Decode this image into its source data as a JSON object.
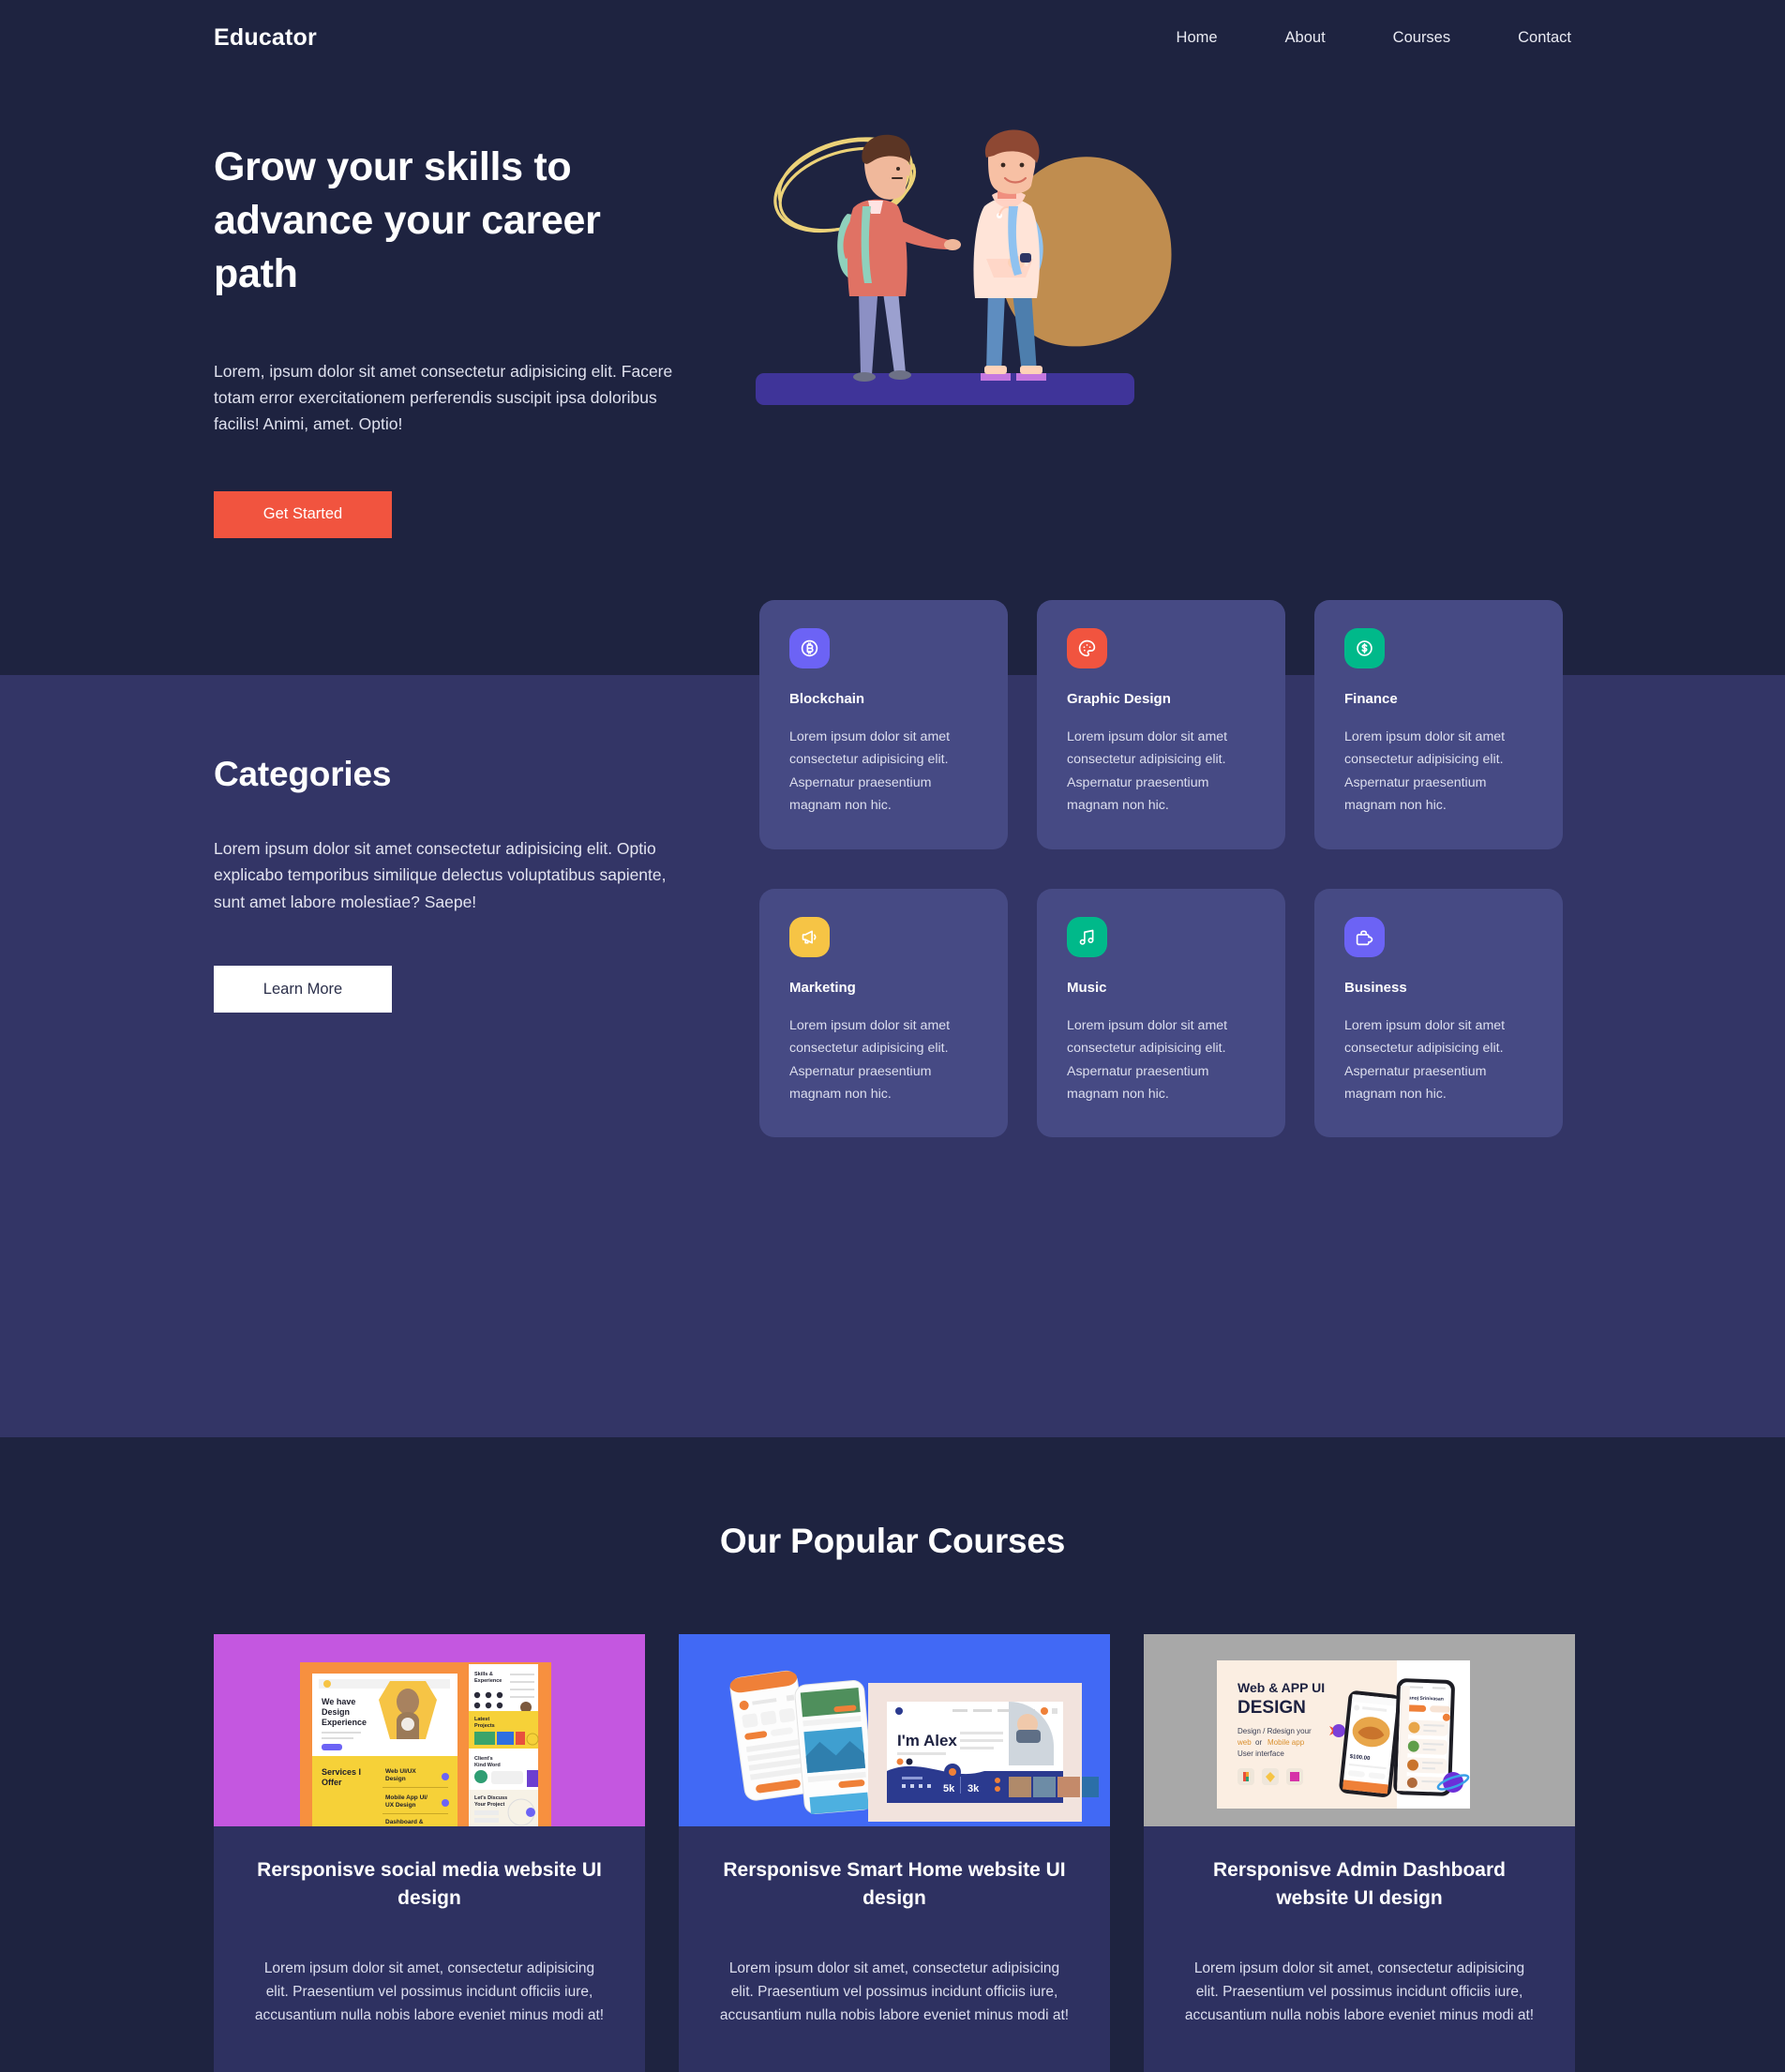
{
  "theme": {
    "bg_dark": "#1e2340",
    "bg_purple": "#333566",
    "card_purple": "#464a84",
    "accent_orange": "#f1543f",
    "course_card_bg": "#2e3161"
  },
  "nav": {
    "brand": "Educator",
    "links": [
      {
        "label": "Home"
      },
      {
        "label": "About"
      },
      {
        "label": "Courses"
      },
      {
        "label": "Contact"
      }
    ]
  },
  "hero": {
    "heading": "Grow your skills to advance your career path",
    "paragraph": "Lorem, ipsum dolor sit amet consectetur adipisicing elit. Facere totam error exercitationem perferendis suscipit ipsa doloribus facilis! Animi, amet. Optio!",
    "cta_label": "Get Started",
    "illustration_name": "two-students-illustration"
  },
  "categories": {
    "heading": "Categories",
    "paragraph": "Lorem ipsum dolor sit amet consectetur adipisicing elit. Optio explicabo temporibus similique delectus voluptatibus sapiente, sunt amet labore molestiae? Saepe!",
    "cta_label": "Learn More",
    "cards": [
      {
        "title": "Blockchain",
        "desc": "Lorem ipsum dolor sit amet consectetur adipisicing elit. Aspernatur praesentium magnam non hic.",
        "icon": "bitcoin-icon",
        "icon_bg": "#6c63f5"
      },
      {
        "title": "Graphic Design",
        "desc": "Lorem ipsum dolor sit amet consectetur adipisicing elit. Aspernatur praesentium magnam non hic.",
        "icon": "palette-icon",
        "icon_bg": "#f1543f"
      },
      {
        "title": "Finance",
        "desc": "Lorem ipsum dolor sit amet consectetur adipisicing elit. Aspernatur praesentium magnam non hic.",
        "icon": "dollar-coin-icon",
        "icon_bg": "#00b98a"
      },
      {
        "title": "Marketing",
        "desc": "Lorem ipsum dolor sit amet consectetur adipisicing elit. Aspernatur praesentium magnam non hic.",
        "icon": "megaphone-icon",
        "icon_bg": "#f6c445"
      },
      {
        "title": "Music",
        "desc": "Lorem ipsum dolor sit amet consectetur adipisicing elit. Aspernatur praesentium magnam non hic.",
        "icon": "music-note-icon",
        "icon_bg": "#00b98a"
      },
      {
        "title": "Business",
        "desc": "Lorem ipsum dolor sit amet consectetur adipisicing elit. Aspernatur praesentium magnam non hic.",
        "icon": "briefcase-icon",
        "icon_bg": "#6c63f5"
      }
    ]
  },
  "courses": {
    "heading": "Our Popular Courses",
    "items": [
      {
        "title": "Rersponisve social media website UI design",
        "desc": "Lorem ipsum dolor sit amet, consectetur adipisicing elit. Praesentium vel possimus incidunt officiis iure, accusantium nulla nobis labore eveniet minus modi at!",
        "thumb_bg": "#c457e0",
        "thumb_name": "social-media-ui-mockup",
        "thumb_texts": {
          "line1": "We have",
          "line2": "Design",
          "line3": "Experience",
          "services": "Services I Offer",
          "item1": "Web UI/UX Design",
          "item2": "Mobile App UI/ UX Design",
          "item3": "Dashboard &",
          "panel1": "Skills & Experience",
          "panel2": "Latest Projects",
          "panel3": "Client's Kind Word",
          "panel4": "Let's Discuss Your Project"
        }
      },
      {
        "title": "Rersponisve Smart Home website UI design",
        "desc": "Lorem ipsum dolor sit amet, consectetur adipisicing elit. Praesentium vel possimus incidunt officiis iure, accusantium nulla nobis labore eveniet minus modi at!",
        "thumb_bg": "#4169f5",
        "thumb_name": "smart-home-ui-mockup",
        "thumb_texts": {
          "hero": "I'm Alex",
          "stat1": "5k",
          "stat2": "3k"
        }
      },
      {
        "title": "Rersponisve Admin Dashboard website UI design",
        "desc": "Lorem ipsum dolor sit amet, consectetur adipisicing elit. Praesentium vel possimus incidunt officiis iure, accusantium nulla nobis labore eveniet minus modi at!",
        "thumb_bg": "#a8a8a8",
        "thumb_name": "admin-dashboard-ui-mockup",
        "thumb_texts": {
          "line1": "Web & APP UI",
          "line2": "DESIGN",
          "sub1": "Design / Rdesign your",
          "sub2a": "web",
          "sub2b": " or ",
          "sub2c": "Mobile app",
          "sub3": "User interface"
        }
      }
    ]
  }
}
